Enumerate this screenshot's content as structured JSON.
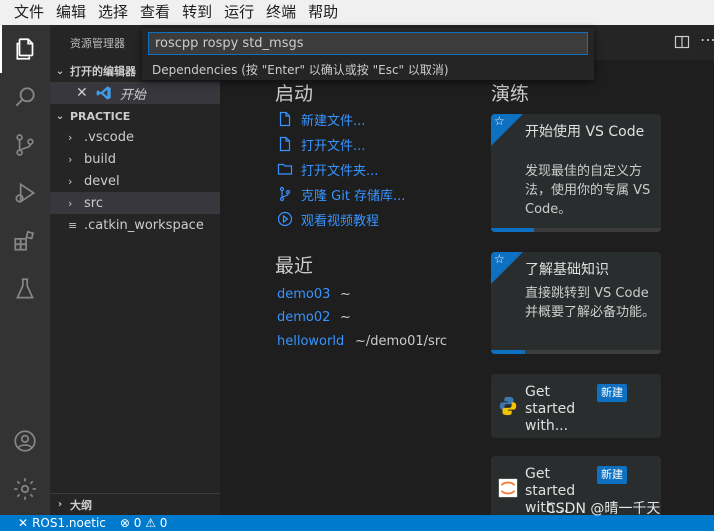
{
  "menubar": [
    "文件",
    "编辑",
    "选择",
    "查看",
    "转到",
    "运行",
    "终端",
    "帮助"
  ],
  "sidebar": {
    "title": "资源管理器",
    "open_editors_header": "打开的编辑器",
    "open_editor_label": "开始",
    "folder_header": "PRACTICE",
    "items": [
      ".vscode",
      "build",
      "devel",
      "src",
      ".catkin_workspace"
    ],
    "outline_header": "大纲"
  },
  "command_palette": {
    "input_value": "roscpp rospy std_msgs",
    "message": "Dependencies (按 \"Enter\" 以确认或按 \"Esc\" 以取消)"
  },
  "welcome": {
    "start_heading": "启动",
    "start_items": [
      "新建文件...",
      "打开文件...",
      "打开文件夹...",
      "克隆 Git 存储库...",
      "观看视频教程"
    ],
    "recent_heading": "最近",
    "recent": [
      {
        "name": "demo03",
        "path": "~"
      },
      {
        "name": "demo02",
        "path": "~"
      },
      {
        "name": "helloworld",
        "path": "~/demo01/src"
      }
    ],
    "walkthrough_heading": "演练",
    "cards": [
      {
        "title": "开始使用 VS Code",
        "desc": "发现最佳的自定义方法，使用你的专属 VS Code。",
        "progress": 0.25
      },
      {
        "title": "了解基础知识",
        "desc": "直接跳转到 VS Code 并概要了解必备功能。",
        "progress": 0.2
      },
      {
        "title": "Get started with...",
        "tag": "新建"
      },
      {
        "title": "Get started with...",
        "tag": "新建"
      }
    ]
  },
  "statusbar": {
    "remote": "ROS1.noetic",
    "problems": "⊗ 0 ⚠ 0"
  },
  "watermark": "CSDN @晴一千天",
  "colors": {
    "accent": "#007acc",
    "link": "#3794ff",
    "card_badge": "#0e70c0"
  }
}
